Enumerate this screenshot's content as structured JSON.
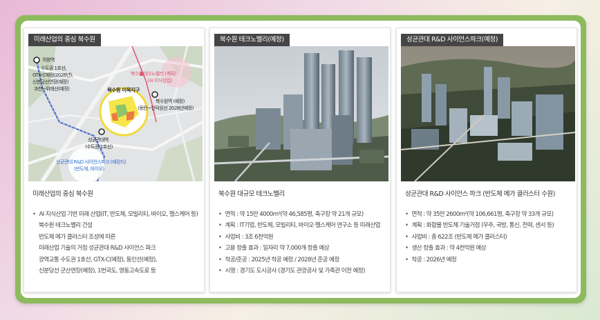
{
  "cards": [
    {
      "tag": "미래산업의 중심 북수원",
      "caption": "미래산업의 중심 북수원",
      "map_labels": {
        "station_top_1": "의왕역",
        "station_top_2": "수도권 1호선,",
        "station_top_3": "GTX-C예정(2028년),",
        "station_top_4": "신분당선연장(예정)",
        "station_top_5": "과천~위례선(예정)",
        "techno_1": "북수원테크노밸리 (계획)",
        "techno_2": "(AI 지식산업)",
        "district": "북수원 이목지구",
        "bugsuwon_1": "북수원역 (예정)",
        "bugsuwon_2": "(동탄~인덕원선 2028년예정)",
        "sungkyun_1": "성균관대역",
        "sungkyun_2": "(수도권 1호선)",
        "park_1": "성균관대 R&D 사이언스파크 (예정지)",
        "park_2": "(반도체, 바이오)"
      },
      "items": [
        {
          "text": "AI 지식산업 기반 미래 산업(IT, 반도체, 모빌리티, 바이오, 헬스케어 등)",
          "bullet": true
        },
        {
          "text": "북수원 테크노밸리 건설",
          "bullet": false
        },
        {
          "text": "반도체 메가 클러스터 조성에 따른",
          "bullet": false
        },
        {
          "text": "미래산업 기술의 거점 성균관대 R&D 사이언스 파크",
          "bullet": false
        },
        {
          "text": "광역교통 수도권 1호선, GTX-C(예정), 동인선(예정),",
          "bullet": false
        },
        {
          "text": "신분당선 군산연장(예정), 1번국도, 영동고속도로 등",
          "bullet": false
        }
      ]
    },
    {
      "tag": "북수원 테크노밸리(예정)",
      "caption": "북수원 대규모 테크노밸리",
      "items": [
        {
          "text": "면적 : 약 15만 4000m²(약 46,585평, 축구장 약 21개 규모)",
          "bullet": true
        },
        {
          "text": "계획 : IT기업, 반도체, 모빌리티, 바이오·헬스케어 연구소 등 미래산업",
          "bullet": true
        },
        {
          "text": "사업비 : 3조 6천억원",
          "bullet": true
        },
        {
          "text": "고용 창출 효과 : 일자리 약 7,000개 창출 예상",
          "bullet": true
        },
        {
          "text": "착공/준공 : 2025년 착공 예정 / 2028년 준공 예정",
          "bullet": true
        },
        {
          "text": "시행 : 경기도 도시공사 (경기도 관광공사 및 가족관 이전 예정)",
          "bullet": true
        }
      ]
    },
    {
      "tag": "성균관대 R&D 사이언스파크(예정)",
      "caption": "성균관대 R&D 사이언스 파크 (반도체 메가 클러스터 수원)",
      "items": [
        {
          "text": "면적 : 약 35만 2600m²(약 106,661평, 축구장 약 33개 규모)",
          "bullet": true
        },
        {
          "text": "계획 : 화합물 반도체 기술거점 (우주, 국방, 통신, 전력, 센서 등)",
          "bullet": true
        },
        {
          "text": "사업비 : 총 622조 (반도체 메가 클러스터)",
          "bullet": true
        },
        {
          "text": "생산 창출 효과 : 약 4천억원 예상",
          "bullet": true
        },
        {
          "text": "착공 : 2026년 예정",
          "bullet": true
        }
      ]
    }
  ],
  "colors": {
    "frame_green": "#8dba5c",
    "tag_bg": "#454545",
    "district_yellow": "#f5e64a",
    "accent_red": "#e0546f",
    "accent_blue": "#2f6fcf"
  }
}
